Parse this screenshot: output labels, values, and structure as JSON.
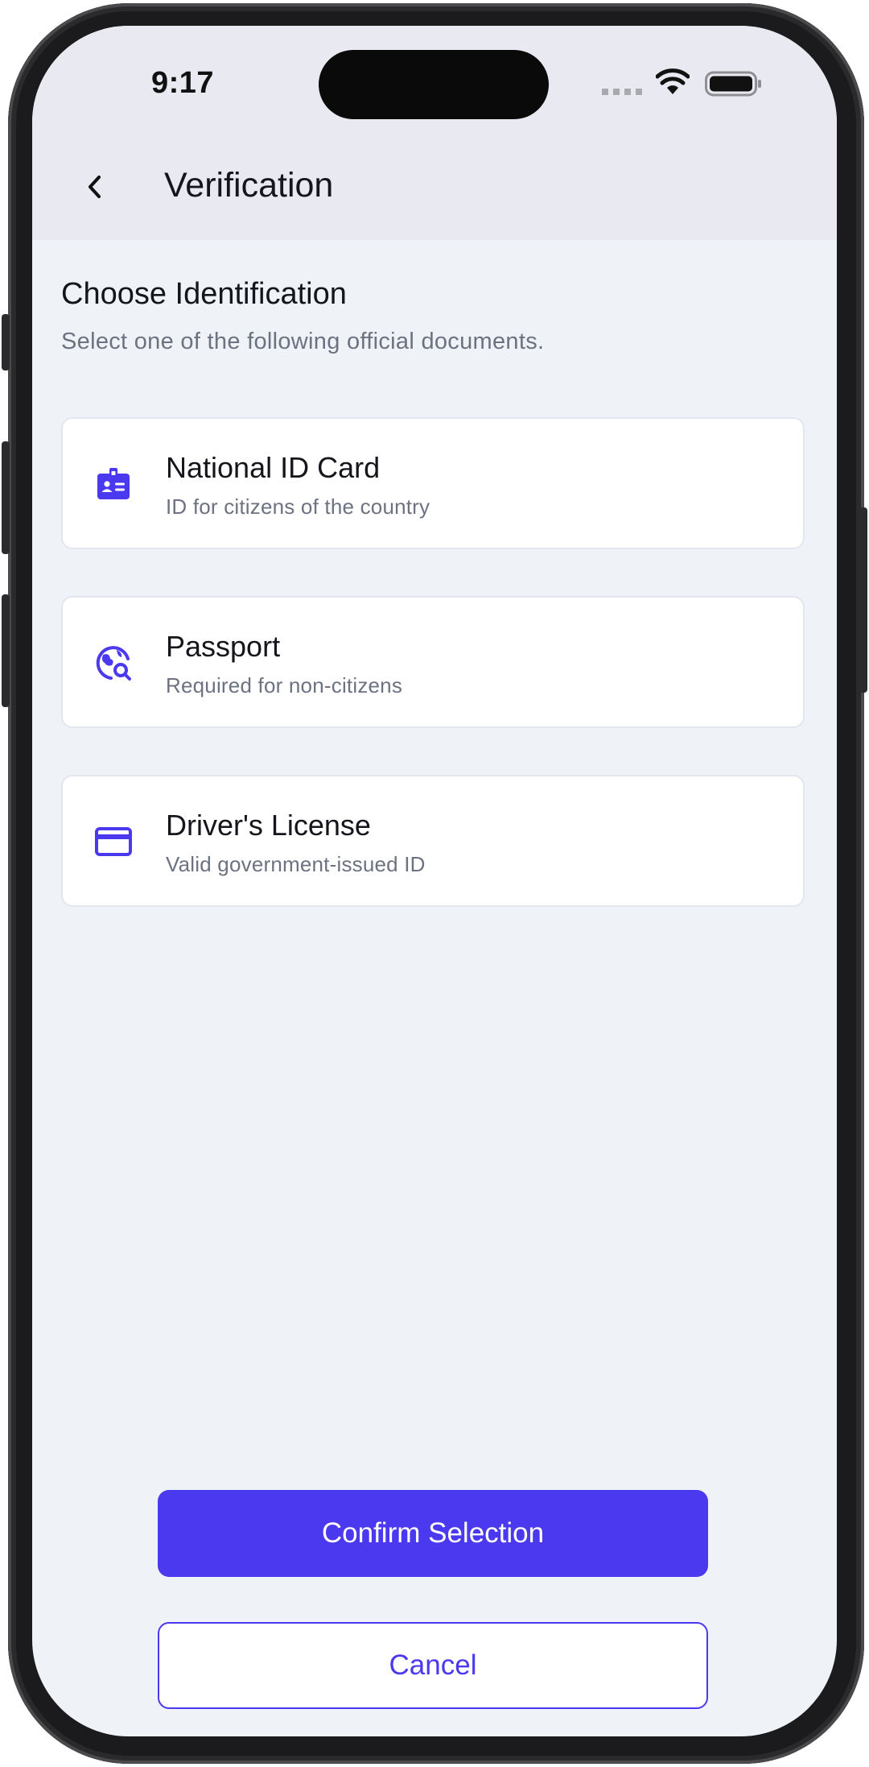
{
  "status_bar": {
    "time": "9:17",
    "wifi_icon": "wifi-icon",
    "battery_icon": "battery-icon"
  },
  "header": {
    "back_icon": "chevron-left-icon",
    "title": "Verification"
  },
  "section": {
    "title": "Choose Identification",
    "subtitle": "Select one of the following official documents."
  },
  "options": [
    {
      "icon": "id-badge-icon",
      "title": "National ID Card",
      "description": "ID for citizens of the country"
    },
    {
      "icon": "globe-search-icon",
      "title": "Passport",
      "description": "Required for non-citizens"
    },
    {
      "icon": "credit-card-icon",
      "title": "Driver's License",
      "description": "Valid government-issued ID"
    }
  ],
  "actions": {
    "confirm_label": "Confirm Selection",
    "cancel_label": "Cancel"
  },
  "colors": {
    "accent": "#4b39ef",
    "header_background": "#e9e9f1",
    "page_background": "#eff2f7",
    "card_background": "#ffffff",
    "muted_text": "#6c7280"
  }
}
